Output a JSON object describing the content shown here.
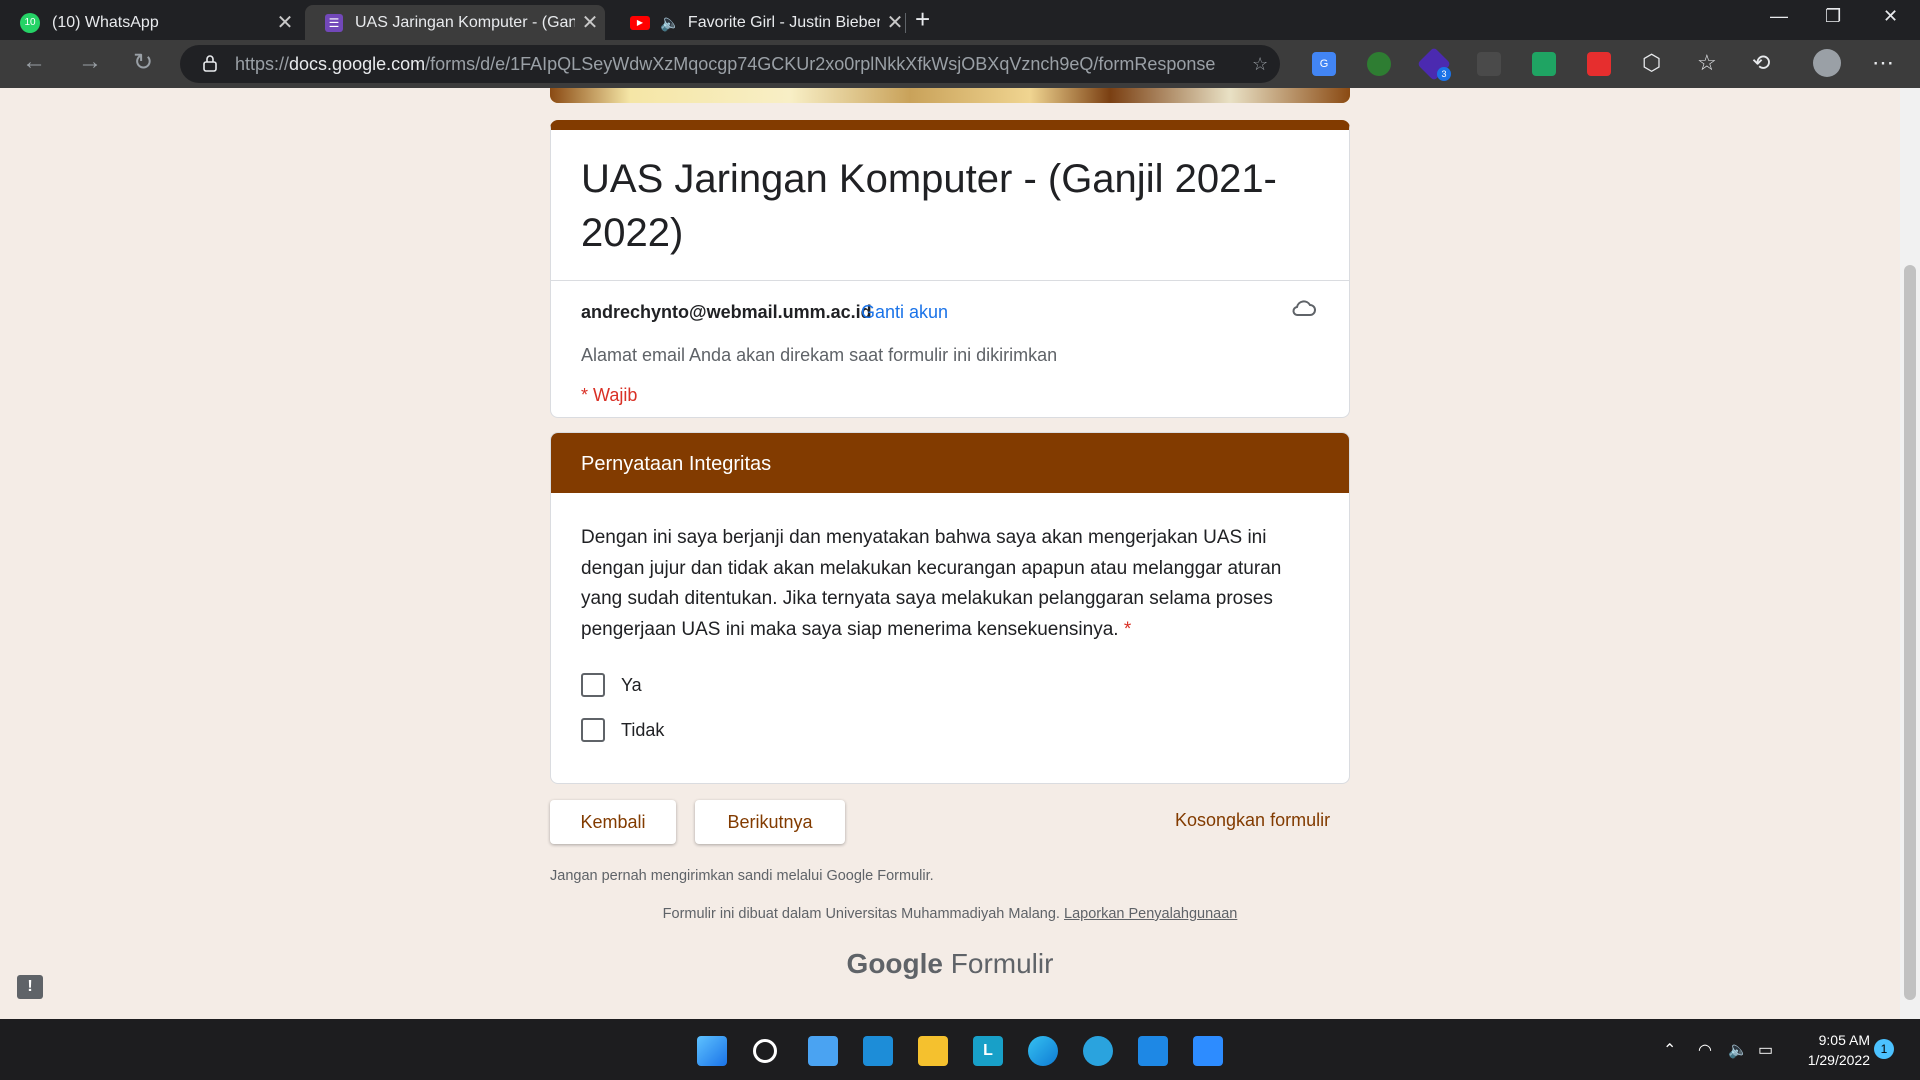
{
  "browser": {
    "tabs": [
      {
        "title": "(10) WhatsApp",
        "badge": "10"
      },
      {
        "title": "UAS Jaringan Komputer - (Ganjil"
      },
      {
        "title": "Favorite Girl - Justin Bieber"
      }
    ],
    "url_prefix": "https://",
    "url_host": "docs.google.com",
    "url_path": "/forms/d/e/1FAIpQLSeyWdwXzMqocgp74GCKUr2xo0rplNkkXfkWsjOBXqVznch9eQ/formResponse",
    "extension_badge": "3"
  },
  "form": {
    "title": "UAS Jaringan Komputer - (Ganjil 2021-2022)",
    "account_email": "andrechynto@webmail.umm.ac.id",
    "switch_account": "Ganti akun",
    "email_notice": "Alamat email Anda akan direkam saat formulir ini dikirimkan",
    "required_note": "* Wajib",
    "section_title": "Pernyataan Integritas",
    "question": "Dengan ini saya berjanji dan menyatakan bahwa saya akan mengerjakan UAS ini dengan jujur dan tidak akan melakukan kecurangan apapun atau melanggar aturan yang sudah ditentukan. Jika ternyata saya melakukan pelanggaran selama proses pengerjaan UAS ini maka saya siap menerima kensekuensinya.",
    "required_star": "*",
    "options": [
      "Ya",
      "Tidak"
    ],
    "back_button": "Kembali",
    "next_button": "Berikutnya",
    "clear_form": "Kosongkan formulir",
    "password_warning": "Jangan pernah mengirimkan sandi melalui Google Formulir.",
    "footer_text": "Formulir ini dibuat dalam Universitas Muhammadiyah Malang.",
    "footer_link": "Laporkan Penyalahgunaan",
    "brand_google": "Google",
    "brand_product": "Formulir",
    "feedback_icon": "!"
  },
  "taskbar": {
    "time": "9:05 AM",
    "date": "1/29/2022",
    "notifications": "1"
  },
  "colors": {
    "theme": "#823b00",
    "link": "#1a73e8",
    "required": "#d93025"
  }
}
